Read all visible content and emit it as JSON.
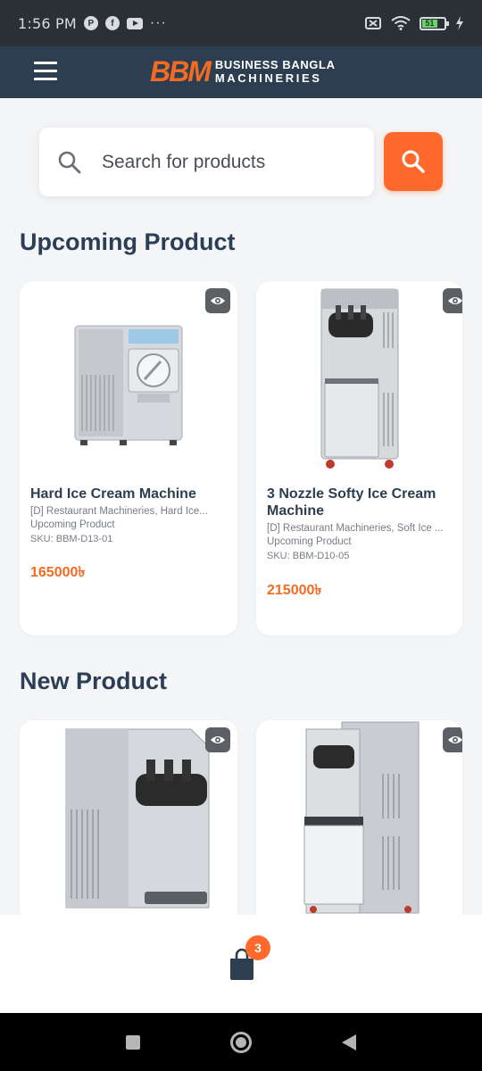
{
  "status_bar": {
    "time": "1:56 PM",
    "battery_level": "51"
  },
  "header": {
    "logo_mark": "BBM",
    "logo_line1": "BUSINESS BANGLA",
    "logo_line2": "MACHINERIES"
  },
  "search": {
    "placeholder": "Search for products"
  },
  "sections": {
    "upcoming_title": "Upcoming Product",
    "new_title": "New Product"
  },
  "upcoming_products": [
    {
      "name": "Hard Ice Cream Machine",
      "category": "[D] Restaurant Machineries, Hard Ice...",
      "status": "Upcoming Product",
      "sku": "SKU: BBM-D13-01",
      "price": "165000৳"
    },
    {
      "name": "3 Nozzle Softy Ice Cream Machine",
      "category": "[D] Restaurant Machineries, Soft Ice ...",
      "status": "Upcoming Product",
      "sku": "SKU: BBM-D10-05",
      "price": "215000৳"
    }
  ],
  "new_products": [
    {
      "image_icon": "softy-machine-image"
    },
    {
      "image_icon": "softy-machine-tall-image"
    }
  ],
  "cart": {
    "count": "3"
  },
  "colors": {
    "accent": "#ff6a2c",
    "header_bg": "#2d3e50",
    "title": "#2c3e56",
    "price": "#f26b24"
  }
}
